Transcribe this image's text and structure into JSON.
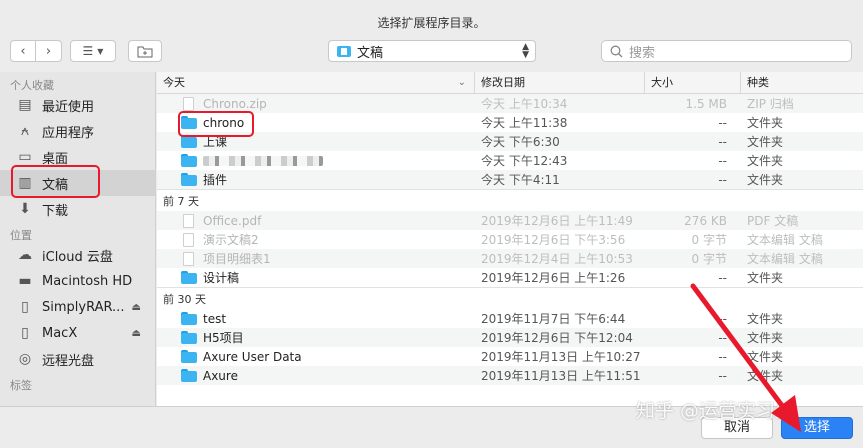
{
  "dialog": {
    "title": "选择扩展程序目录。"
  },
  "toolbar": {
    "location": "文稿",
    "search_placeholder": "搜索"
  },
  "sidebar": {
    "favorites_header": "个人收藏",
    "favorites": [
      {
        "label": "最近使用",
        "icon": "recent-icon"
      },
      {
        "label": "应用程序",
        "icon": "applications-icon"
      },
      {
        "label": "桌面",
        "icon": "desktop-icon"
      },
      {
        "label": "文稿",
        "icon": "documents-icon",
        "active": true
      },
      {
        "label": "下载",
        "icon": "download-icon"
      }
    ],
    "locations_header": "位置",
    "locations": [
      {
        "label": "iCloud 云盘",
        "icon": "cloud-icon"
      },
      {
        "label": "Macintosh HD",
        "icon": "disk-icon"
      },
      {
        "label": "SimplyRAR...",
        "icon": "disk-icon",
        "eject": true
      },
      {
        "label": "MacX",
        "icon": "disk-icon",
        "eject": true
      },
      {
        "label": "远程光盘",
        "icon": "disc-icon"
      }
    ],
    "tags_header": "标签"
  },
  "columns": {
    "name": "今天",
    "date": "修改日期",
    "size": "大小",
    "kind": "种类"
  },
  "sections": {
    "today_rows": [
      {
        "name": "Chrono.zip",
        "date": "今天 上午10:34",
        "size": "1.5 MB",
        "kind": "ZIP 归档",
        "type": "doc",
        "dim": true
      },
      {
        "name": "chrono",
        "date": "今天 上午11:38",
        "size": "--",
        "kind": "文件夹",
        "type": "folder"
      },
      {
        "name": "上课",
        "date": "今天 下午6:30",
        "size": "--",
        "kind": "文件夹",
        "type": "folder"
      },
      {
        "name": "",
        "date": "今天 下午12:43",
        "size": "--",
        "kind": "文件夹",
        "type": "folder",
        "blurred": true
      },
      {
        "name": "插件",
        "date": "今天 下午4:11",
        "size": "--",
        "kind": "文件夹",
        "type": "folder"
      }
    ],
    "week_header": "前 7 天",
    "week_rows": [
      {
        "name": "Office.pdf",
        "date": "2019年12月6日 上午11:49",
        "size": "276 KB",
        "kind": "PDF 文稿",
        "type": "doc",
        "dim": true
      },
      {
        "name": "演示文稿2",
        "date": "2019年12月6日 下午3:56",
        "size": "0 字节",
        "kind": "文本编辑 文稿",
        "type": "doc",
        "dim": true
      },
      {
        "name": "项目明细表1",
        "date": "2019年12月4日 上午10:53",
        "size": "0 字节",
        "kind": "文本编辑 文稿",
        "type": "doc",
        "dim": true
      },
      {
        "name": "设计稿",
        "date": "2019年12月6日 上午1:26",
        "size": "--",
        "kind": "文件夹",
        "type": "folder"
      }
    ],
    "month_header": "前 30 天",
    "month_rows": [
      {
        "name": "test",
        "date": "2019年11月7日 下午6:44",
        "size": "--",
        "kind": "文件夹",
        "type": "folder"
      },
      {
        "name": "H5项目",
        "date": "2019年12月6日 下午12:04",
        "size": "--",
        "kind": "文件夹",
        "type": "folder"
      },
      {
        "name": "Axure User Data",
        "date": "2019年11月13日 上午10:27",
        "size": "--",
        "kind": "文件夹",
        "type": "folder"
      },
      {
        "name": "Axure",
        "date": "2019年11月13日 上午11:51",
        "size": "--",
        "kind": "文件夹",
        "type": "folder"
      }
    ]
  },
  "buttons": {
    "cancel": "取消",
    "choose": "选择"
  },
  "watermark": "知乎 @运营实习生",
  "colors": {
    "accent": "#2a82f4",
    "folder": "#3db4f2",
    "annotation": "#e8192c"
  }
}
